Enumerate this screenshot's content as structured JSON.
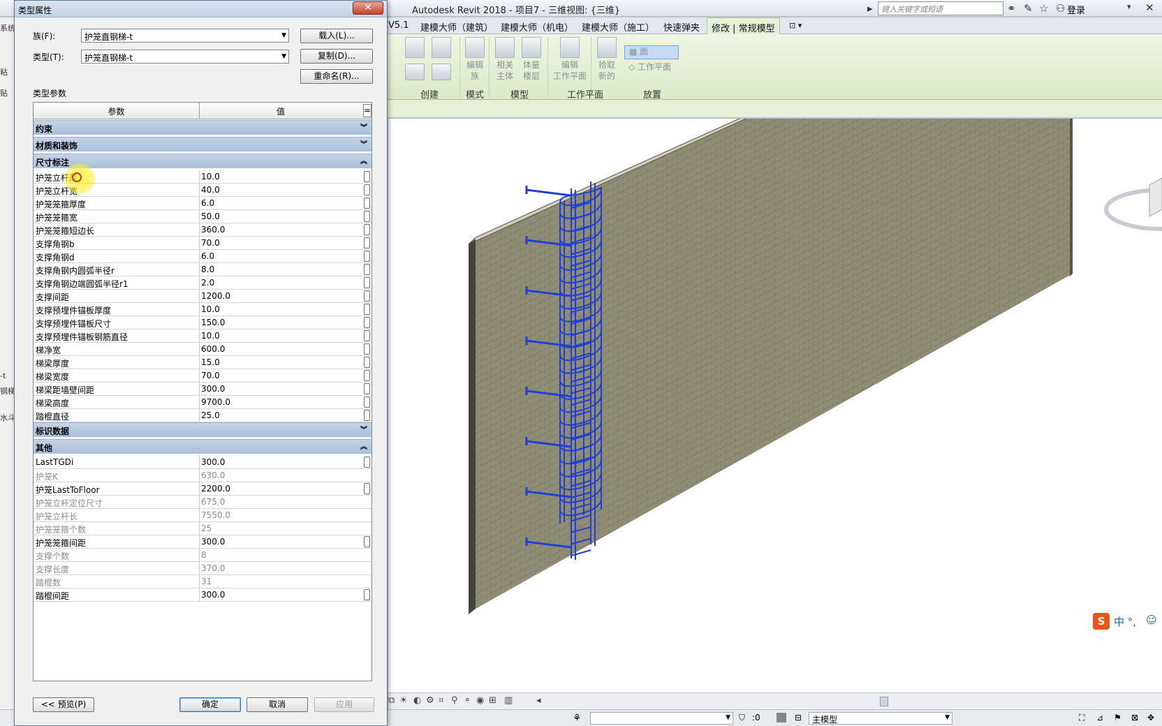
{
  "app": {
    "title": "Autodesk Revit 2018 -     项目7 - 三维视图: {三维}",
    "search_placeholder": "键入关键字或短语",
    "login": "登录"
  },
  "ribbon": {
    "tabs": [
      {
        "label": "V5.1",
        "active": false
      },
      {
        "label": "建模大师（建筑）",
        "active": false
      },
      {
        "label": "建模大师（机电）",
        "active": false
      },
      {
        "label": "建模大师（施工）",
        "active": false
      },
      {
        "label": "快速弹夹",
        "active": false
      },
      {
        "label": "修改 | 常规模型",
        "active": true
      }
    ],
    "buttons": {
      "edit_family": "编辑\n族",
      "related_host": "相关\n主体",
      "mass_floors": "体量\n楼层",
      "edit_workplane": "编辑\n工作平面",
      "pick_new": "拾取\n新的",
      "face": "面",
      "workplane": "工作平面"
    },
    "groups": {
      "create": "创建",
      "mode": "模式",
      "model": "模型",
      "workplane": "工作平面",
      "placement": "放置"
    }
  },
  "left_strip": {
    "items": [
      "系统",
      "粘",
      "贴",
      "-t",
      "钢梯",
      "水斗"
    ]
  },
  "dialog": {
    "title": "类型属性",
    "family_label": "族(F):",
    "family_value": "护笼直钢梯-t",
    "type_label": "类型(T):",
    "type_value": "护笼直钢梯-t",
    "load_btn": "载入(L)...",
    "duplicate_btn": "复制(D)...",
    "rename_btn": "重命名(R)...",
    "type_params_label": "类型参数",
    "col_param": "参数",
    "col_value": "值",
    "col_eq": "=",
    "groups": [
      {
        "name": "约束",
        "expanded": false,
        "rows": []
      },
      {
        "name": "材质和装饰",
        "expanded": false,
        "rows": []
      },
      {
        "name": "尺寸标注",
        "expanded": true,
        "rows": [
          {
            "name": "护笼立杆厚",
            "value": "10.0",
            "editable": true
          },
          {
            "name": "护笼立杆宽",
            "value": "40.0",
            "editable": true
          },
          {
            "name": "护笼笼箍厚度",
            "value": "6.0",
            "editable": true
          },
          {
            "name": "护笼笼箍宽",
            "value": "50.0",
            "editable": true
          },
          {
            "name": "护笼笼箍短边长",
            "value": "360.0",
            "editable": true
          },
          {
            "name": "支撑角钢b",
            "value": "70.0",
            "editable": true
          },
          {
            "name": "支撑角钢d",
            "value": "6.0",
            "editable": true
          },
          {
            "name": "支撑角钢内圆弧半径r",
            "value": "8.0",
            "editable": true
          },
          {
            "name": "支撑角钢边端圆弧半径r1",
            "value": "2.0",
            "editable": true
          },
          {
            "name": "支撑间距",
            "value": "1200.0",
            "editable": true
          },
          {
            "name": "支撑预埋件锚板厚度",
            "value": "10.0",
            "editable": true
          },
          {
            "name": "支撑预埋件锚板尺寸",
            "value": "150.0",
            "editable": true
          },
          {
            "name": "支撑预埋件锚板钢筋直径",
            "value": "10.0",
            "editable": true
          },
          {
            "name": "梯净宽",
            "value": "600.0",
            "editable": true
          },
          {
            "name": "梯梁厚度",
            "value": "15.0",
            "editable": true
          },
          {
            "name": "梯梁宽度",
            "value": "70.0",
            "editable": true
          },
          {
            "name": "梯梁距墙壁间距",
            "value": "300.0",
            "editable": true
          },
          {
            "name": "梯梁高度",
            "value": "9700.0",
            "editable": true
          },
          {
            "name": "踏棍直径",
            "value": "25.0",
            "editable": true
          }
        ]
      },
      {
        "name": "标识数据",
        "expanded": false,
        "rows": []
      },
      {
        "name": "其他",
        "expanded": true,
        "rows": [
          {
            "name": "LastTGDi",
            "value": "300.0",
            "editable": true
          },
          {
            "name": "护笼K",
            "value": "630.0",
            "editable": false
          },
          {
            "name": "护笼LastToFloor",
            "value": "2200.0",
            "editable": true
          },
          {
            "name": "护笼立杆定位尺寸",
            "value": "675.0",
            "editable": false
          },
          {
            "name": "护笼立杆长",
            "value": "7550.0",
            "editable": false
          },
          {
            "name": "护笼笼箍个数",
            "value": "25",
            "editable": false
          },
          {
            "name": "护笼笼箍间距",
            "value": "300.0",
            "editable": true
          },
          {
            "name": "支撑个数",
            "value": "8",
            "editable": false
          },
          {
            "name": "支撑长度",
            "value": "370.0",
            "editable": false
          },
          {
            "name": "踏棍数",
            "value": "31",
            "editable": false
          },
          {
            "name": "踏棍间距",
            "value": "300.0",
            "editable": true
          }
        ]
      }
    ],
    "preview_btn": "<< 预览(P)",
    "ok_btn": "确定",
    "cancel_btn": "取消",
    "apply_btn": "应用"
  },
  "statusbar": {
    "filter_count": ":0",
    "main_model": "主模型"
  },
  "ime": {
    "label": "中 °,"
  },
  "colors": {
    "ribbon_bg": "#e3edd0",
    "group_header": "#b3c7de",
    "ladder": "#1f3fd6",
    "wall_face": "#8d8b73",
    "wall_edge": "#55554a"
  }
}
